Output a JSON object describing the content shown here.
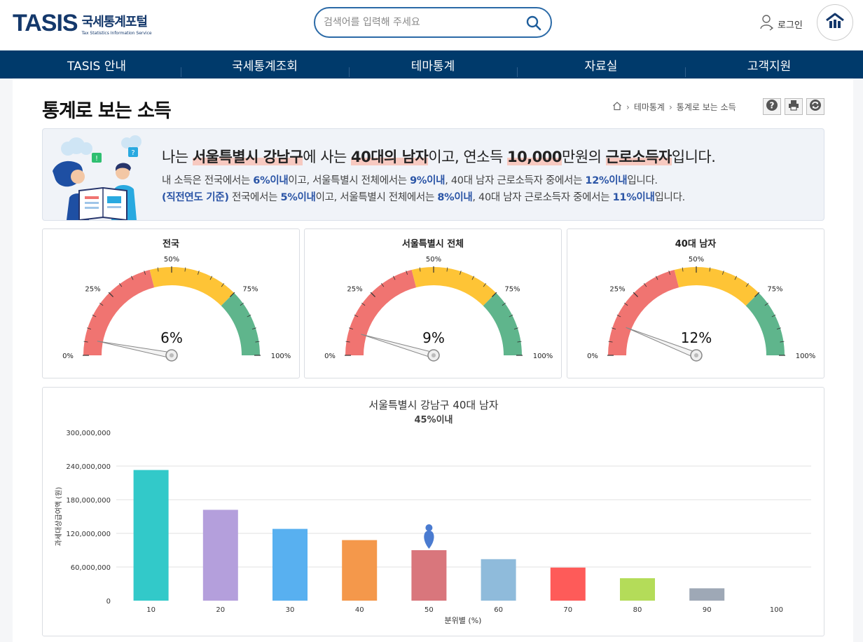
{
  "header": {
    "logo_mark": "TASIS",
    "logo_korean": "국세통계포털",
    "logo_english": "Tax Statistics Information Service",
    "search_placeholder": "검색어를 입력해 주세요",
    "login_label": "로그인"
  },
  "nav": {
    "items": [
      {
        "label": "TASIS 안내"
      },
      {
        "label": "국세통계조회"
      },
      {
        "label": "테마통계"
      },
      {
        "label": "자료실"
      },
      {
        "label": "고객지원"
      }
    ]
  },
  "page": {
    "title": "통계로 보는 소득",
    "breadcrumb": [
      "테마통계",
      "통계로 보는 소득"
    ]
  },
  "summary": {
    "line1": {
      "p1": "나는 ",
      "region": "서울특별시 강남구",
      "p2": "에 사는 ",
      "group": "40대의 남자",
      "p3": "이고, 연소득 ",
      "amount": "10,000",
      "p4": "만원의 ",
      "type": "근로소득자",
      "p5": "입니다."
    },
    "line2": {
      "p1": "내 소득은 전국에서는 ",
      "v1": "6%이내",
      "p2": "이고, 서울특별시 전체에서는 ",
      "v2": "9%이내",
      "p3": ", 40대 남자 근로소득자 중에서는 ",
      "v3": "12%이내",
      "p4": "입니다."
    },
    "line3": {
      "prefix": "(직전연도 기준)",
      "p1": " 전국에서는 ",
      "v1": "5%이내",
      "p2": "이고, 서울특별시 전체에서는 ",
      "v2": "8%이내",
      "p3": ", 40대 남자 근로소득자 중에서는 ",
      "v3": "11%이내",
      "p4": "입니다."
    }
  },
  "gauges": [
    {
      "title": "전국",
      "value": 6,
      "value_label": "6%"
    },
    {
      "title": "서울특별시 전체",
      "value": 9,
      "value_label": "9%"
    },
    {
      "title": "40대 남자",
      "value": 12,
      "value_label": "12%"
    }
  ],
  "gauge_labels": {
    "t0": "0%",
    "t25": "25%",
    "t50": "50%",
    "t75": "75%",
    "t100": "100%"
  },
  "gauge_colors": {
    "low": "#f07471",
    "mid": "#fec436",
    "high": "#5fb58c"
  },
  "chart_data": {
    "type": "bar",
    "title": "서울특별시 강남구 40대 남자",
    "subtitle": "45%이내",
    "xlabel": "분위별 (%)",
    "ylabel": "과세대상급여액 (원)",
    "ylim": [
      0,
      300000000
    ],
    "yticks": [
      "0",
      "60,000,000",
      "120,000,000",
      "180,000,000",
      "240,000,000",
      "300,000,000"
    ],
    "categories": [
      "10",
      "20",
      "30",
      "40",
      "50",
      "60",
      "70",
      "80",
      "90",
      "100"
    ],
    "values": [
      233000000,
      162000000,
      128000000,
      108000000,
      90000000,
      74000000,
      59000000,
      40000000,
      22000000,
      0
    ],
    "colors": [
      "#32c9c9",
      "#b49fdc",
      "#58b0f0",
      "#f4984b",
      "#d9767c",
      "#8fbbdb",
      "#fe5b59",
      "#b4dc59",
      "#9ea8b6",
      "#cccccc"
    ],
    "marker_category": "50",
    "grid": true
  }
}
